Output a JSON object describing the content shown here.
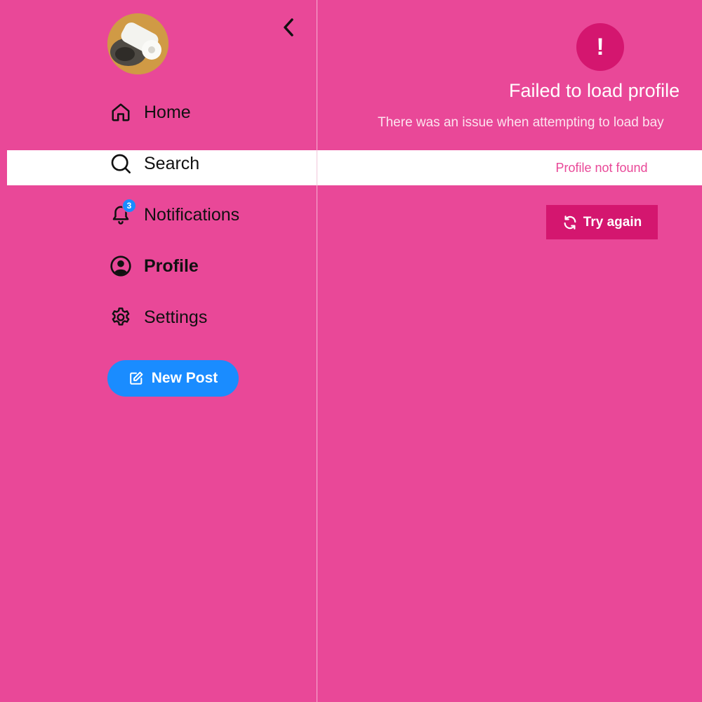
{
  "nav": {
    "items": [
      {
        "label": "Home",
        "icon": "home-icon"
      },
      {
        "label": "Search",
        "icon": "search-icon"
      },
      {
        "label": "Notifications",
        "icon": "bell-icon",
        "badge": "3"
      },
      {
        "label": "Profile",
        "icon": "user-circle-icon",
        "active": true
      },
      {
        "label": "Settings",
        "icon": "gear-icon"
      }
    ],
    "new_post_label": "New Post",
    "collapse_icon": "chevron-left-icon"
  },
  "error": {
    "icon_glyph": "!",
    "title": "Failed to load profile",
    "description": "There was an issue when attempting to load bay",
    "detail": "Profile not found",
    "retry_label": "Try again",
    "retry_icon": "refresh-icon"
  },
  "colors": {
    "background": "#e94898",
    "accent_blue": "#1a8cff",
    "error_accent": "#d4166f",
    "highlight": "#ffffff"
  }
}
